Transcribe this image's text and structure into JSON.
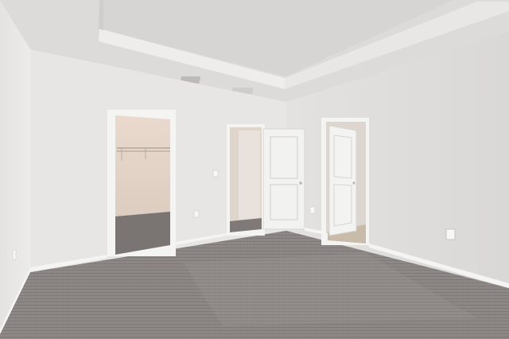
{
  "scene": {
    "kind": "empty bedroom interior",
    "elements": [
      "tray-ceiling",
      "ceiling-vent",
      "walk-in-closet",
      "bathroom-doorway",
      "hall-door",
      "carpet-floor",
      "wall-outlets",
      "baseboards"
    ],
    "colors": {
      "ceiling": "#dddcdb",
      "tray_face": "#e9e8e6",
      "wall_left": "#ebebea",
      "wall_back": "#e7e6e4",
      "wall_right": "#e2e1df",
      "closet_interior": "#e8d8cc",
      "doorway_warm": "#e2d6c9",
      "door": "#f2f2f1",
      "trim": "#f4f4f3",
      "carpet": "#8e8986",
      "carpet_dark": "#6f6a67"
    }
  },
  "watermark": {
    "text": ""
  }
}
